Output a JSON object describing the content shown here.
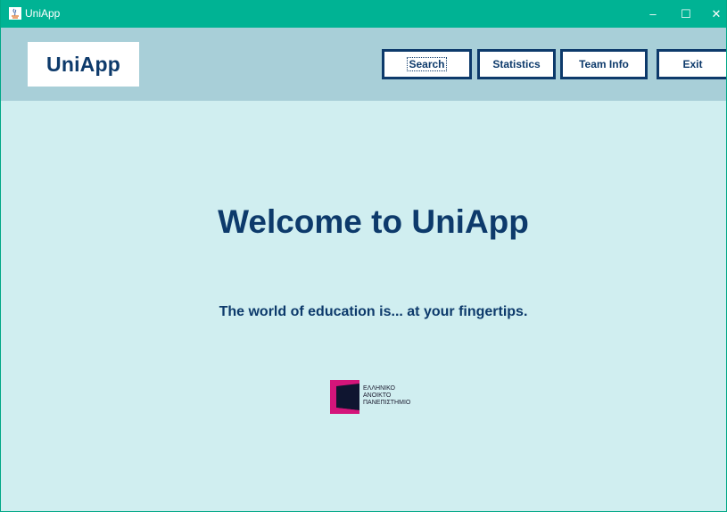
{
  "window": {
    "title": "UniApp",
    "controls": {
      "minimize": "–",
      "maximize": "☐",
      "close": "✕"
    }
  },
  "header": {
    "logo_text": "UniApp",
    "nav": {
      "search": "Search",
      "statistics": "Statistics",
      "team_info": "Team Info",
      "exit": "Exit"
    }
  },
  "main": {
    "welcome": "Welcome to UniApp",
    "tagline": "The world of education is... at your fingertips.",
    "university_logo": {
      "line1": "ΕΛΛΗΝΙΚΟ",
      "line2": "ΑΝΟΙΚΤΟ",
      "line3": "ΠΑΝΕΠΙΣΤΗΜΙΟ"
    }
  },
  "colors": {
    "titlebar": "#00b394",
    "header": "#a8cfd8",
    "background": "#d0eef0",
    "brand_navy": "#0d3a6b",
    "logo_magenta": "#d4157a"
  }
}
